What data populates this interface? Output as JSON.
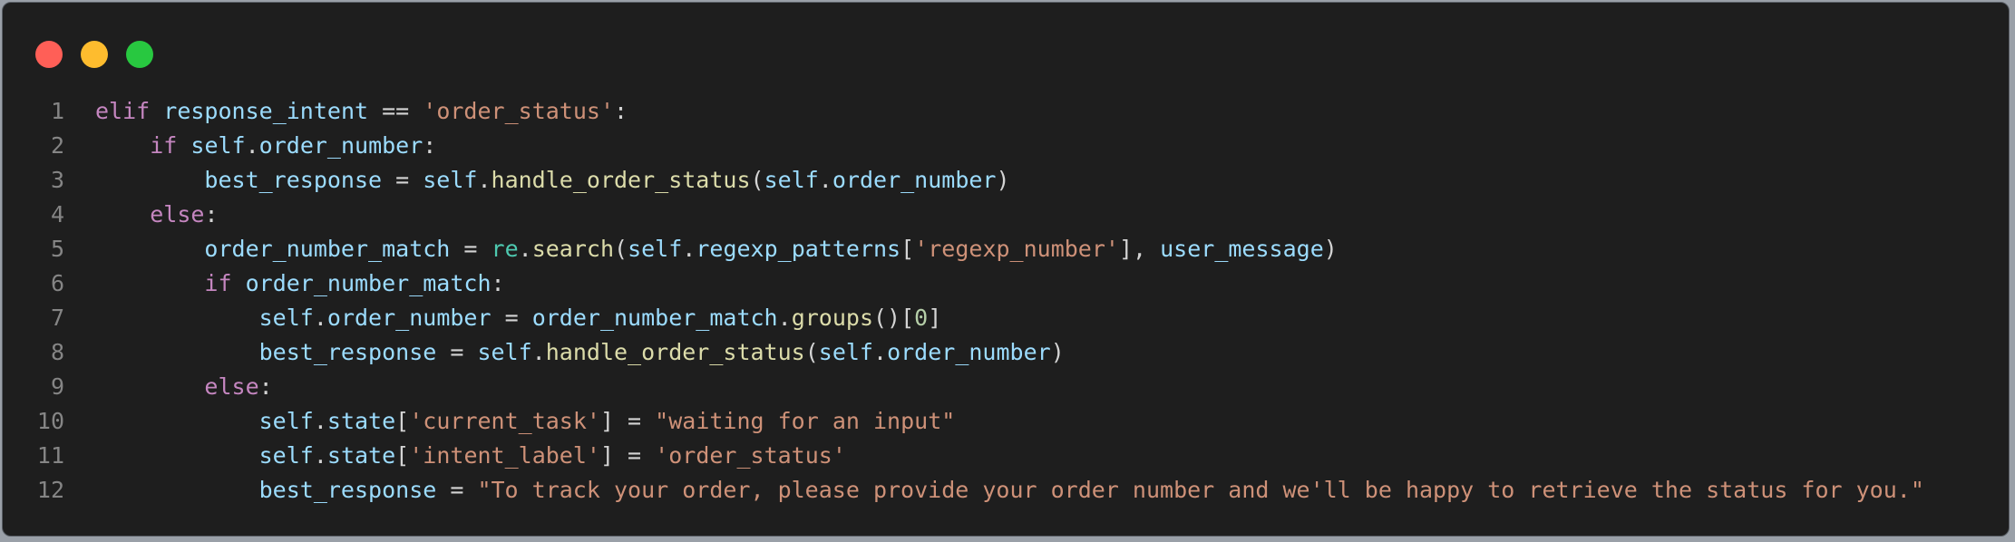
{
  "colors": {
    "background": "#1e1e1e",
    "keyword": "#c586c0",
    "variable": "#9cdcfe",
    "function": "#dcdcaa",
    "string": "#ce9178",
    "number": "#b5cea8",
    "module": "#4ec9b0",
    "punctuation": "#d4d4d4",
    "line_number": "#858585"
  },
  "window_controls": [
    {
      "name": "close",
      "color": "#ff5f57"
    },
    {
      "name": "minimize",
      "color": "#febc2e"
    },
    {
      "name": "zoom",
      "color": "#28c840"
    }
  ],
  "code": {
    "language": "python",
    "lines": [
      {
        "number": "1",
        "indent": 0,
        "tokens": [
          {
            "t": "kw",
            "v": "elif"
          },
          {
            "t": "p",
            "v": " "
          },
          {
            "t": "var",
            "v": "response_intent"
          },
          {
            "t": "p",
            "v": " == "
          },
          {
            "t": "str",
            "v": "'order_status'"
          },
          {
            "t": "p",
            "v": ":"
          }
        ]
      },
      {
        "number": "2",
        "indent": 1,
        "tokens": [
          {
            "t": "kw",
            "v": "if"
          },
          {
            "t": "p",
            "v": " "
          },
          {
            "t": "var",
            "v": "self"
          },
          {
            "t": "p",
            "v": "."
          },
          {
            "t": "var",
            "v": "order_number"
          },
          {
            "t": "p",
            "v": ":"
          }
        ]
      },
      {
        "number": "3",
        "indent": 2,
        "tokens": [
          {
            "t": "var",
            "v": "best_response"
          },
          {
            "t": "p",
            "v": " = "
          },
          {
            "t": "var",
            "v": "self"
          },
          {
            "t": "p",
            "v": "."
          },
          {
            "t": "fn",
            "v": "handle_order_status"
          },
          {
            "t": "p",
            "v": "("
          },
          {
            "t": "var",
            "v": "self"
          },
          {
            "t": "p",
            "v": "."
          },
          {
            "t": "var",
            "v": "order_number"
          },
          {
            "t": "p",
            "v": ")"
          }
        ]
      },
      {
        "number": "4",
        "indent": 1,
        "tokens": [
          {
            "t": "kw",
            "v": "else"
          },
          {
            "t": "p",
            "v": ":"
          }
        ]
      },
      {
        "number": "5",
        "indent": 2,
        "tokens": [
          {
            "t": "var",
            "v": "order_number_match"
          },
          {
            "t": "p",
            "v": " = "
          },
          {
            "t": "mod",
            "v": "re"
          },
          {
            "t": "p",
            "v": "."
          },
          {
            "t": "fn",
            "v": "search"
          },
          {
            "t": "p",
            "v": "("
          },
          {
            "t": "var",
            "v": "self"
          },
          {
            "t": "p",
            "v": "."
          },
          {
            "t": "var",
            "v": "regexp_patterns"
          },
          {
            "t": "p",
            "v": "["
          },
          {
            "t": "str",
            "v": "'regexp_number'"
          },
          {
            "t": "p",
            "v": "], "
          },
          {
            "t": "var",
            "v": "user_message"
          },
          {
            "t": "p",
            "v": ")"
          }
        ]
      },
      {
        "number": "6",
        "indent": 2,
        "tokens": [
          {
            "t": "kw",
            "v": "if"
          },
          {
            "t": "p",
            "v": " "
          },
          {
            "t": "var",
            "v": "order_number_match"
          },
          {
            "t": "p",
            "v": ":"
          }
        ]
      },
      {
        "number": "7",
        "indent": 3,
        "tokens": [
          {
            "t": "var",
            "v": "self"
          },
          {
            "t": "p",
            "v": "."
          },
          {
            "t": "var",
            "v": "order_number"
          },
          {
            "t": "p",
            "v": " = "
          },
          {
            "t": "var",
            "v": "order_number_match"
          },
          {
            "t": "p",
            "v": "."
          },
          {
            "t": "fn",
            "v": "groups"
          },
          {
            "t": "p",
            "v": "()["
          },
          {
            "t": "num",
            "v": "0"
          },
          {
            "t": "p",
            "v": "]"
          }
        ]
      },
      {
        "number": "8",
        "indent": 3,
        "tokens": [
          {
            "t": "var",
            "v": "best_response"
          },
          {
            "t": "p",
            "v": " = "
          },
          {
            "t": "var",
            "v": "self"
          },
          {
            "t": "p",
            "v": "."
          },
          {
            "t": "fn",
            "v": "handle_order_status"
          },
          {
            "t": "p",
            "v": "("
          },
          {
            "t": "var",
            "v": "self"
          },
          {
            "t": "p",
            "v": "."
          },
          {
            "t": "var",
            "v": "order_number"
          },
          {
            "t": "p",
            "v": ")"
          }
        ]
      },
      {
        "number": "9",
        "indent": 2,
        "tokens": [
          {
            "t": "kw",
            "v": "else"
          },
          {
            "t": "p",
            "v": ":"
          }
        ]
      },
      {
        "number": "10",
        "indent": 3,
        "tokens": [
          {
            "t": "var",
            "v": "self"
          },
          {
            "t": "p",
            "v": "."
          },
          {
            "t": "var",
            "v": "state"
          },
          {
            "t": "p",
            "v": "["
          },
          {
            "t": "str",
            "v": "'current_task'"
          },
          {
            "t": "p",
            "v": "] = "
          },
          {
            "t": "str",
            "v": "\"waiting for an input\""
          }
        ]
      },
      {
        "number": "11",
        "indent": 3,
        "tokens": [
          {
            "t": "var",
            "v": "self"
          },
          {
            "t": "p",
            "v": "."
          },
          {
            "t": "var",
            "v": "state"
          },
          {
            "t": "p",
            "v": "["
          },
          {
            "t": "str",
            "v": "'intent_label'"
          },
          {
            "t": "p",
            "v": "] = "
          },
          {
            "t": "str",
            "v": "'order_status'"
          }
        ]
      },
      {
        "number": "12",
        "indent": 3,
        "tokens": [
          {
            "t": "var",
            "v": "best_response"
          },
          {
            "t": "p",
            "v": " = "
          },
          {
            "t": "str",
            "v": "\"To track your order, please provide your order number and we'll be happy to retrieve the status for you.\""
          }
        ]
      }
    ]
  }
}
